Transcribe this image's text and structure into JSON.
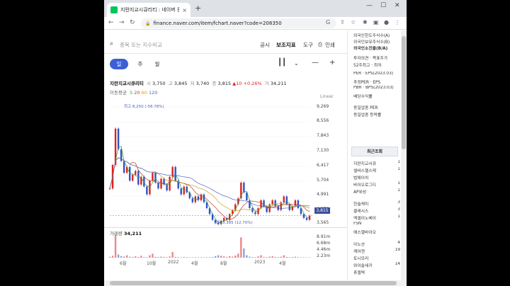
{
  "browser": {
    "tab_title": "지란지교시큐리티 : 네이버 증권",
    "tab_close": "×",
    "new_tab": "+",
    "url": "finance.naver.com/item/fchart.naver?code=208350",
    "back": "←",
    "forward": "→",
    "reload": "↻"
  },
  "toolbar": {
    "search_placeholder": "종목 또는 지수비교",
    "menu_disclosure": "공시",
    "menu_indicator": "보조지표",
    "menu_tools": "도구",
    "menu_print": "인쇄"
  },
  "periods": {
    "day": "일",
    "week": "주",
    "month": "월"
  },
  "quote": {
    "name": "지란지교시큐리티",
    "open_label": "시",
    "open": "3,750",
    "high_label": "고",
    "high": "3,845",
    "low_label": "저",
    "low": "3,740",
    "close_label": "종",
    "close": "3,815",
    "change": "▲10",
    "change_pct": "+0.26%",
    "volume_label": "거",
    "volume": "34,211"
  },
  "ma_legend": {
    "label": "이동평균",
    "ma5": "5",
    "ma20": "20",
    "ma60": "60",
    "ma120": "120"
  },
  "scale_mode": "Linear",
  "annotations": {
    "high": "최고 8,250 (-58.78%)",
    "low": "최저 3,385 (12.70%)"
  },
  "volume_panel": {
    "label": "거래량",
    "value": "34,211"
  },
  "colors": {
    "accent": "#3c5fd6",
    "up": "#e0201b",
    "down": "#2b53c9",
    "ma5": "#2f9e44",
    "ma20": "#c0392b",
    "ma60": "#d4a017",
    "ma120": "#4a63c7"
  },
  "chart_data": [
    {
      "type": "line",
      "title": "",
      "x": [
        "6월",
        "10월",
        "2022",
        "4월",
        "8월",
        "2023",
        "4월"
      ],
      "y_ticks": [
        "9,269",
        "8,556",
        "7,843",
        "7,130",
        "6,417",
        "5,704",
        "4,991",
        "4,278",
        "3,565"
      ],
      "ylim": [
        3300,
        9500
      ],
      "last_value": "3,815",
      "series": [
        {
          "values": [
            5200,
            6400,
            8250,
            7200,
            6600,
            6000,
            6300,
            5600,
            5900,
            6100,
            5400,
            5800,
            5300,
            4900,
            5600,
            6000,
            5500,
            5200,
            5700,
            5400,
            5100,
            5800,
            6300,
            5600,
            5200,
            4900,
            5300,
            5000,
            4700,
            4500,
            4800,
            4600,
            4900,
            4500,
            4200,
            3900,
            3600,
            3450,
            3385,
            3550,
            3700,
            3600,
            3900,
            4100,
            4400,
            4700,
            5500,
            5000,
            4600,
            4200,
            4000,
            3900,
            4200,
            4600,
            4300,
            4000,
            4400,
            4600,
            4300,
            4100,
            4500,
            4800,
            4400,
            4100,
            4300,
            4600,
            4200,
            3900,
            3700,
            3600,
            3815
          ]
        }
      ]
    },
    {
      "type": "bar",
      "title": "",
      "y_ticks": [
        "8.91m",
        "6.68m",
        "4.46m",
        "2.23m"
      ],
      "ylim": [
        0,
        8910000
      ],
      "values": [
        300000,
        700000,
        8500000,
        1200000,
        600000,
        400000,
        900000,
        350000,
        300000,
        500000,
        280000,
        700000,
        250000,
        200000,
        900000,
        1500000,
        300000,
        250000,
        400000,
        280000,
        200000,
        450000,
        2100000,
        300000,
        220000,
        180000,
        260000,
        200000,
        160000,
        140000,
        200000,
        150000,
        180000,
        150000,
        160000,
        200000,
        250000,
        600000,
        900000,
        700000,
        500000,
        300000,
        600000,
        400000,
        800000,
        1500000,
        7500000,
        3400000,
        900000,
        400000,
        250000,
        200000,
        500000,
        900000,
        300000,
        200000,
        400000,
        600000,
        300000,
        200000,
        350000,
        900000,
        300000,
        200000,
        250000,
        350000,
        200000,
        150000,
        140000,
        130000,
        34211
      ]
    }
  ],
  "sidebar": {
    "top_items": [
      {
        "label": "외국인한도주식수(A)",
        "value": ""
      },
      {
        "label": "외국인보유주식수(B)",
        "value": ""
      },
      {
        "label": "외국인소진율(B/A)",
        "value": ""
      },
      {
        "label": "투자의견 · 목표주가",
        "value": ""
      },
      {
        "label": "52주최고 · 최저",
        "value": ""
      },
      {
        "label": "PER · EPS(2023.03)",
        "value": ""
      },
      {
        "label": "추정PER · EPS",
        "value": ""
      },
      {
        "label": "PBR · BPS(2023.03)",
        "value": ""
      },
      {
        "label": "배당수익률",
        "value": ""
      },
      {
        "label": "동일업종 PER",
        "value": ""
      },
      {
        "label": "동일업종 등락률",
        "value": ""
      }
    ],
    "recent_title": "최근조회",
    "recent": [
      {
        "label": "지란지교시큐",
        "count": "1"
      },
      {
        "label": "셀바스헬스케",
        "count": "1"
      },
      {
        "label": "법에이치",
        "count": ""
      },
      {
        "label": "바이오로그디",
        "count": "1"
      },
      {
        "label": "AP위성",
        "count": "1"
      },
      {
        "label": "한솔케미",
        "count": "3"
      },
      {
        "label": "클래시스",
        "count": "3"
      },
      {
        "label": "엑셀이노베이",
        "count": "1"
      },
      {
        "label": "FSN",
        "count": ""
      },
      {
        "label": "에스엘바이오",
        "count": ""
      },
      {
        "label": "이노션",
        "count": "4"
      },
      {
        "label": "케어젠",
        "count": "19"
      },
      {
        "label": "토니모리",
        "count": ""
      },
      {
        "label": "와이솔세키",
        "count": "14"
      },
      {
        "label": "휴젤텍",
        "count": ""
      }
    ]
  }
}
